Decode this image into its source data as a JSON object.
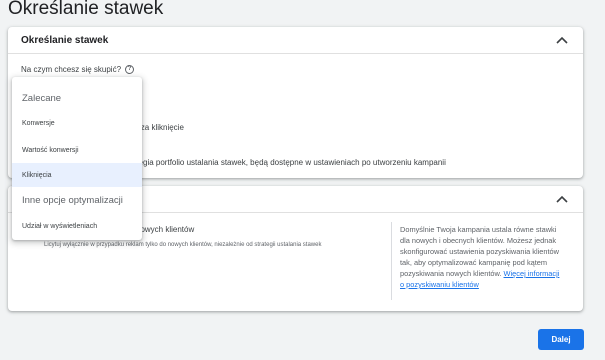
{
  "page": {
    "title": "Określanie stawek"
  },
  "bidding_card": {
    "title": "Określanie stawek",
    "question": "Na czym chcesz się skupić?",
    "help_glyph": "?",
    "bg_line1": "wki za kliknięcie",
    "bg_line2": "trategia portfolio ustalania stawek, będą dostępne w ustawieniach po utworzeniu kampanii"
  },
  "customer_card": {
    "label": "nowych klientów",
    "description": "Licytuj wyłącznie w przypadku reklam tylko do nowych klientów, niezależnie od strategii ustalania stawek",
    "help_text": "Domyślnie Twoja kampania ustala równe stawki dla nowych i obecnych klientów. Możesz jednak skonfigurować ustawienia pozyskiwania klientów tak, aby optymalizować kampanię pod kątem pozyskiwania nowych klientów.",
    "help_link": "Więcej informacji o pozyskiwaniu klientów"
  },
  "dropdown": {
    "recommended_header": "Zalecane",
    "items": [
      {
        "label": "Konwersje",
        "selected": false
      },
      {
        "label": "Wartość konwersji",
        "selected": false
      },
      {
        "label": "Kliknięcia",
        "selected": true
      }
    ],
    "other_header": "Inne opcje optymalizacji",
    "other_items": [
      {
        "label": "Udział w wyświetleniach",
        "selected": false
      }
    ]
  },
  "footer": {
    "next_label": "Dalej"
  },
  "icons": {
    "collapse": "chevron-up-icon",
    "help": "help-circle-icon"
  },
  "colors": {
    "accent": "#1a73e8",
    "selected_bg": "#e8f0fe",
    "page_bg": "#f1f3f4"
  }
}
